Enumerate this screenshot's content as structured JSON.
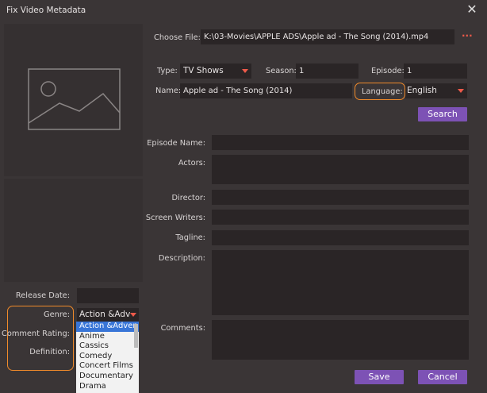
{
  "window": {
    "title": "Fix Video Metadata"
  },
  "file": {
    "label": "Choose File:",
    "path": "K:\\03-Movies\\APPLE ADS\\Apple ad - The Song (2014).mp4",
    "browse": "···"
  },
  "type": {
    "label": "Type:",
    "value": "TV Shows"
  },
  "season": {
    "label": "Season:",
    "value": "1"
  },
  "episode": {
    "label": "Episode:",
    "value": "1"
  },
  "name": {
    "label": "Name:",
    "value": "Apple ad - The Song (2014)"
  },
  "language": {
    "label": "Language:",
    "value": "English"
  },
  "search_button": "Search",
  "fields": {
    "episode_name": "Episode Name:",
    "actors": "Actors:",
    "director": "Director:",
    "screen_writers": "Screen Writers:",
    "tagline": "Tagline:",
    "description": "Description:",
    "comments": "Comments:"
  },
  "left": {
    "release_date": "Release Date:",
    "genre": "Genre:",
    "genre_value": "Action &Adv",
    "comment_rating": "Comment Rating:",
    "definition": "Definition:"
  },
  "genre_options": [
    "Action &Adven",
    "Anime",
    "Cassics",
    "Comedy",
    "Concert Films",
    "Documentary",
    "Drama"
  ],
  "actions": {
    "save": "Save",
    "cancel": "Cancel"
  },
  "colors": {
    "accent": "#7d52b5",
    "highlight": "#f08a2a",
    "arrow": "#ef5a4a"
  }
}
